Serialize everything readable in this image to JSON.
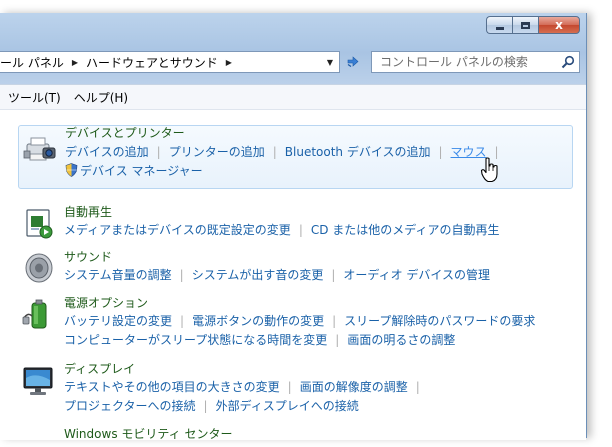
{
  "window": {
    "minimize_label": "minimize",
    "maximize_label": "maximize",
    "close_label": "x"
  },
  "address": {
    "crumbs": [
      "ール パネル",
      "ハードウェアとサウンド"
    ],
    "separator": "▶",
    "dropdown": "▼"
  },
  "search": {
    "placeholder": "コントロール パネルの検索"
  },
  "menu": {
    "items": [
      "ツール(T)",
      "ヘルプ(H)"
    ]
  },
  "categories": [
    {
      "title": "デバイスとプリンター",
      "icon": "printer-camera-icon",
      "links_row1": [
        "デバイスの追加",
        "プリンターの追加",
        "Bluetooth デバイスの追加",
        "マウス"
      ],
      "links_row2": [
        "デバイス マネージャー"
      ]
    },
    {
      "title": "自動再生",
      "icon": "autoplay-icon",
      "links_row1": [
        "メディアまたはデバイスの既定設定の変更",
        "CD または他のメディアの自動再生"
      ]
    },
    {
      "title": "サウンド",
      "icon": "speaker-icon",
      "links_row1": [
        "システム音量の調整",
        "システムが出す音の変更",
        "オーディオ デバイスの管理"
      ]
    },
    {
      "title": "電源オプション",
      "icon": "battery-icon",
      "links_row1": [
        "バッテリ設定の変更",
        "電源ボタンの動作の変更",
        "スリープ解除時のパスワードの要求"
      ],
      "links_row2": [
        "コンピューターがスリープ状態になる時間を変更",
        "画面の明るさの調整"
      ]
    },
    {
      "title": "ディスプレイ",
      "icon": "monitor-icon",
      "links_row1": [
        "テキストやその他の項目の大きさの変更",
        "画面の解像度の調整"
      ],
      "links_row2": [
        "プロジェクターへの接続",
        "外部ディスプレイへの接続"
      ]
    },
    {
      "title": "Windows モビリティ センター",
      "icon": "mobility-icon"
    }
  ],
  "colors": {
    "category_title": "#1e5a1a",
    "link": "#1a61a8",
    "link_hover": "#3a8ae8",
    "highlight_border": "#b8d6f2"
  }
}
